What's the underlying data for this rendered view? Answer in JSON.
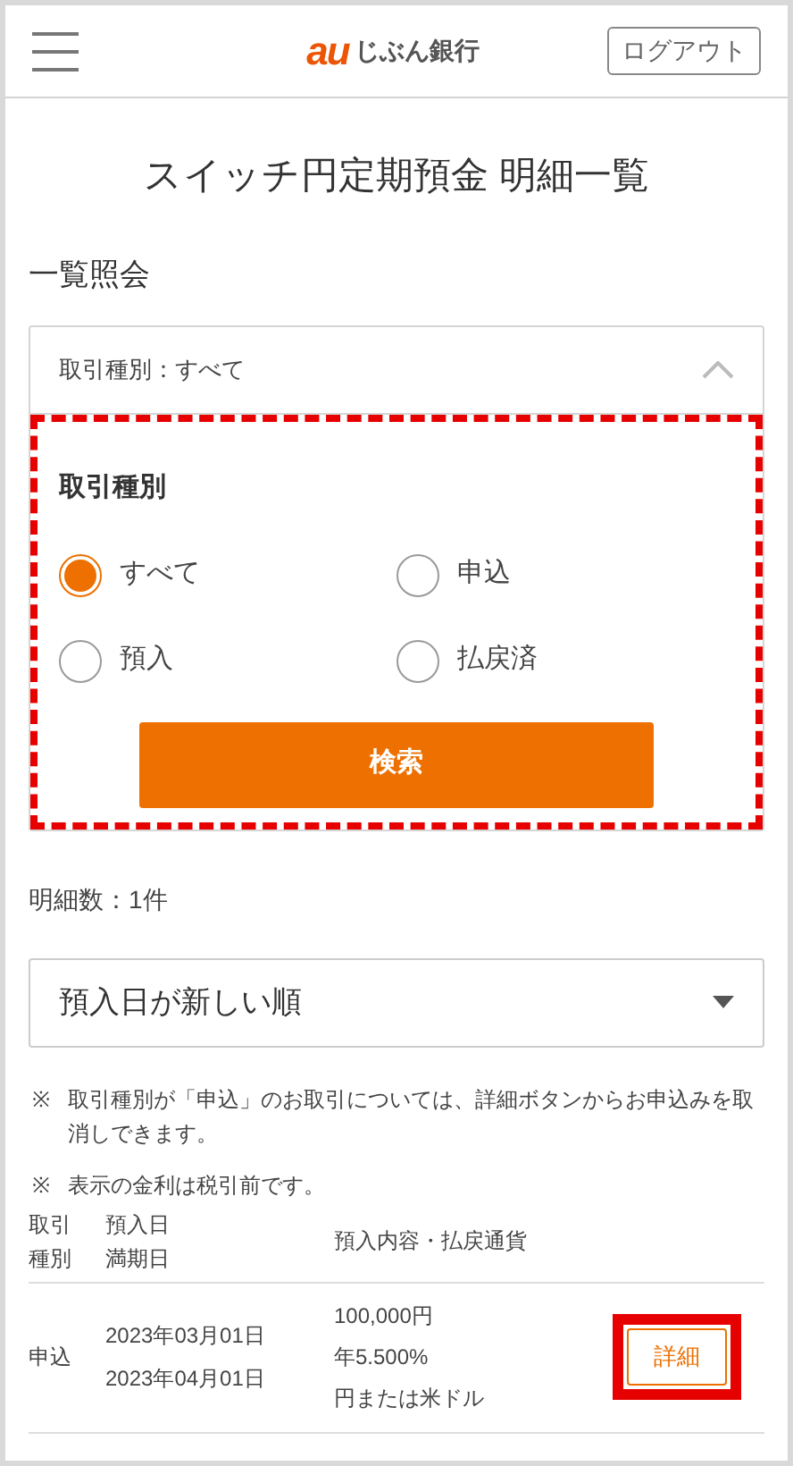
{
  "header": {
    "logo": {
      "mark": "au",
      "name": "じぶん銀行"
    },
    "logout_button": "ログアウト"
  },
  "title": "スイッチ円定期預金 明細一覧",
  "section_title": "一覧照会",
  "filter": {
    "summary": "取引種別：すべて",
    "expanded": true,
    "heading": "取引種別",
    "options": [
      {
        "label": "すべて",
        "selected": true
      },
      {
        "label": "申込",
        "selected": false
      },
      {
        "label": "預入",
        "selected": false
      },
      {
        "label": "払戻済",
        "selected": false
      }
    ],
    "search_button": "検索"
  },
  "result_count": "明細数：1件",
  "sort": {
    "value": "預入日が新しい順"
  },
  "notes": [
    {
      "mark": "※",
      "text": "取引種別が「申込」のお取引については、詳細ボタンからお申込みを取消しできます。"
    },
    {
      "mark": "※",
      "text": "表示の金利は税引前です。"
    }
  ],
  "table": {
    "columns": [
      [
        "取引",
        "種別"
      ],
      [
        "預入日",
        "満期日"
      ],
      [
        "預入内容・払戻通貨"
      ]
    ],
    "rows": [
      {
        "type": "申込",
        "dates": [
          "2023年03月01日",
          "2023年04月01日"
        ],
        "details": [
          "100,000円",
          "年5.500%",
          "円または米ドル"
        ],
        "button": "詳細"
      }
    ]
  }
}
